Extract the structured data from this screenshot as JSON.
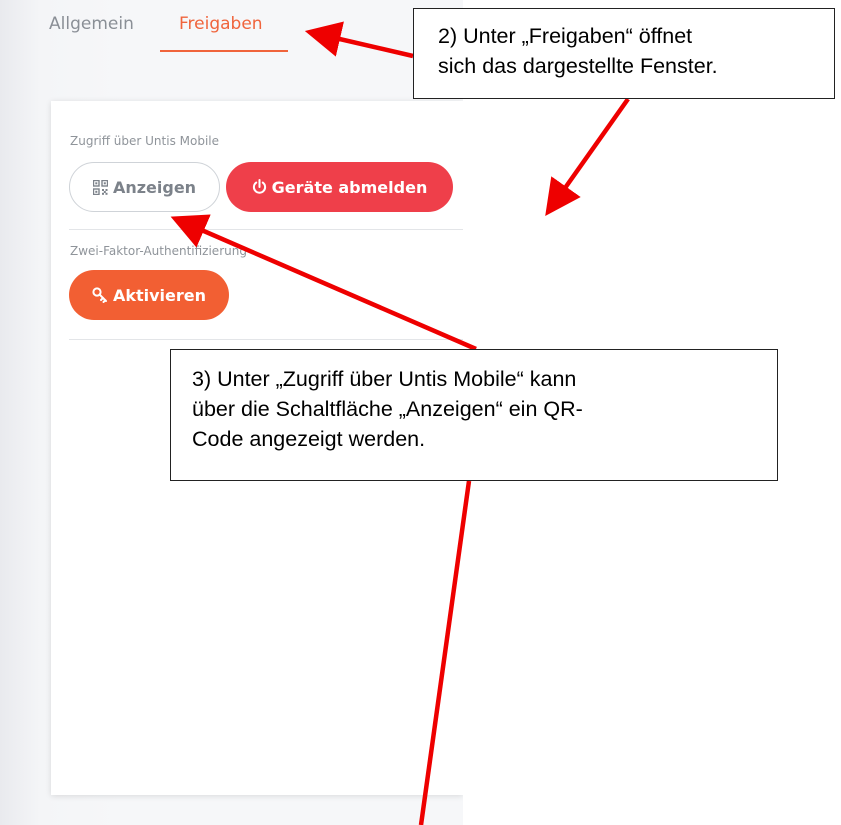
{
  "tabs": {
    "general": "Allgemein",
    "shares": "Freigaben",
    "active_color": "#f0643c"
  },
  "panel": {
    "mobile_access_label": "Zugriff über Untis Mobile",
    "show_button": "Anzeigen",
    "show_button_icon": "qr-code-icon",
    "logout_button": "Geräte abmelden",
    "logout_button_icon": "power-icon",
    "logout_color": "#ef3f4a",
    "two_factor_label": "Zwei-Faktor-Authentifizierung",
    "activate_button": "Aktivieren",
    "activate_button_icon": "key-icon",
    "activate_color": "#f25f33"
  },
  "callouts": {
    "step2": {
      "line1": "2) Unter „Freigaben“ öffnet",
      "line2": "sich das dargestellte Fenster."
    },
    "step3": {
      "line1": "3) Unter „Zugriff über Untis Mobile“ kann",
      "line2": "über die Schaltfläche „Anzeigen“ ein QR-",
      "line3": "Code angezeigt werden."
    },
    "arrow_color": "#ee0000"
  }
}
